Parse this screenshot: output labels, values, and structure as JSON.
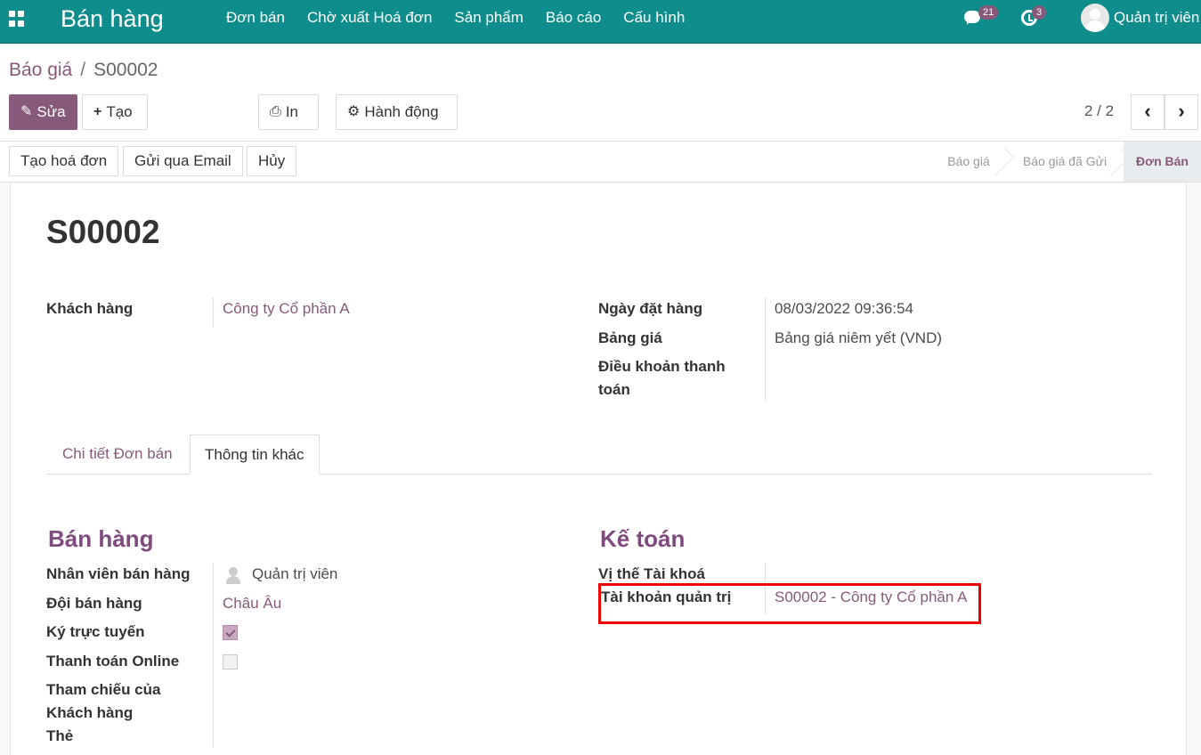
{
  "topbar": {
    "app_title": "Bán hàng",
    "menu": [
      "Đơn bán",
      "Chờ xuất Hoá đơn",
      "Sản phẩm",
      "Báo cáo",
      "Cấu hình"
    ],
    "messages_count": "21",
    "activities_count": "3",
    "user_name": "Quản trị viên"
  },
  "breadcrumb": {
    "parent": "Báo giá",
    "separator": "/",
    "current": "S00002"
  },
  "toolbar": {
    "edit_label": "Sửa",
    "create_label": "Tạo",
    "print_label": "In",
    "action_label": "Hành động",
    "pager_value": "2 / 2"
  },
  "statusbar": {
    "buttons": [
      "Tạo hoá đơn",
      "Gửi qua Email",
      "Hủy"
    ],
    "stages": [
      "Báo giá",
      "Báo giá đã Gửi",
      "Đơn Bán"
    ],
    "active_stage": "Đơn Bán"
  },
  "form": {
    "title": "S00002",
    "customer_label": "Khách hàng",
    "customer_value": "Công ty Cổ phần A",
    "order_date_label": "Ngày đặt hàng",
    "order_date_value": "08/03/2022 09:36:54",
    "pricelist_label": "Bảng giá",
    "pricelist_value": "Bảng giá niêm yết (VND)",
    "payment_terms_label_1": "Điều khoản thanh",
    "payment_terms_label_2": "toán"
  },
  "tabs": [
    {
      "label": "Chi tiết Đơn bán",
      "active": false
    },
    {
      "label": "Thông tin khác",
      "active": true
    }
  ],
  "sales_section": {
    "title": "Bán hàng",
    "salesperson_label": "Nhân viên bán hàng",
    "salesperson_value": "Quản trị viên",
    "team_label": "Đội bán hàng",
    "team_value": "Châu Âu",
    "online_sign_label": "Ký trực tuyến",
    "online_sign_checked": true,
    "online_pay_label": "Thanh toán Online",
    "online_pay_checked": false,
    "customer_ref_label_1": "Tham chiếu của",
    "customer_ref_label_2": "Khách hàng",
    "tags_label": "Thẻ"
  },
  "accounting_section": {
    "title": "Kế toán",
    "fiscal_position_label": "Vị thế Tài khoá",
    "analytic_account_label": "Tài khoản quản trị",
    "analytic_account_value": "S00002 - Công ty Cổ phần A"
  },
  "colors": {
    "topbar": "#0f8c8c",
    "brand": "#875a7b",
    "highlight": "#ee0000"
  }
}
